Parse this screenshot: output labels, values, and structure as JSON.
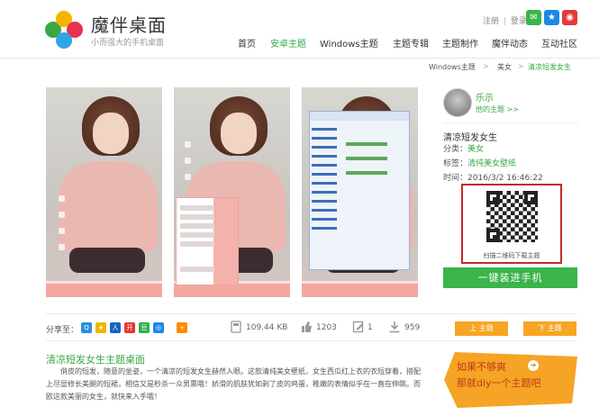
{
  "header": {
    "brand": "魔伴桌面",
    "slogan": "小而强大的手机桌面",
    "register": "注册",
    "separator": "|",
    "login": "登录",
    "social_icons": [
      "wechat-icon",
      "qzone-icon",
      "weibo-icon"
    ],
    "nav": [
      "首页",
      "安卓主题",
      "Windows主题",
      "主题专辑",
      "主题制作",
      "魔伴动态",
      "互动社区"
    ],
    "active_nav": "安卓主题"
  },
  "breadcrumb": {
    "items": [
      "Windows主题",
      "美女",
      "清凉短发女生"
    ],
    "separator": ">"
  },
  "screenshots": {
    "count": 3,
    "window_menu_lines": [
      "控制面板",
      "日期和时间",
      "声音",
      "系统",
      "系统和安全",
      "程序和功能",
      "用户账户",
      "默认程序",
      "设备和打印机",
      "游戏",
      "任务管理器",
      "WiFi共享"
    ]
  },
  "sidebar": {
    "author_name": "乐示",
    "their_themes": "他的主题 >>",
    "title": "清凉短发女生",
    "category_label": "分类：",
    "category_value": "美女",
    "tags_label": "标签：",
    "tags_value": "清纯美女壁纸",
    "time_label": "时间：",
    "time_value": "2016/3/2 16:46:22",
    "qr_caption": "扫描二维码下载主题",
    "install_button": "一键装进手机"
  },
  "meta": {
    "share_label": "分享至：",
    "share_icons": [
      "qq-icon",
      "qzone-icon",
      "renren-icon",
      "kaixin-icon",
      "douban-icon",
      "tencent-weibo-icon",
      "plus-icon"
    ],
    "file_size": "109.44 KB",
    "likes": "1203",
    "comments": "1",
    "downloads": "959",
    "prev_label": "上  主题",
    "next_label": "下  主题"
  },
  "description": {
    "title": "清凉短发女生主题桌面",
    "text": "俏皮的短发，随意的坐姿，一个清凉的短发女生赫然入眼。这款清纯美女壁纸，女生西瓜红上衣的衣短穿着，搭配上尽显修长美腿的短裙，相信又是秒杀一众男票哦！娇滑的肌肤犹如剥了皮的鸡蛋，稚嫩的表情似乎在一直在伸跳。而欧这款美丽的女生，就快来入手哦！"
  },
  "promo": {
    "line1": "如果不够爽",
    "line2": "那就diy一个主题吧"
  },
  "colors": {
    "accent_green": "#39a844",
    "install_green": "#39b54a",
    "orange": "#f6a623",
    "qr_border": "#c02c2c"
  }
}
